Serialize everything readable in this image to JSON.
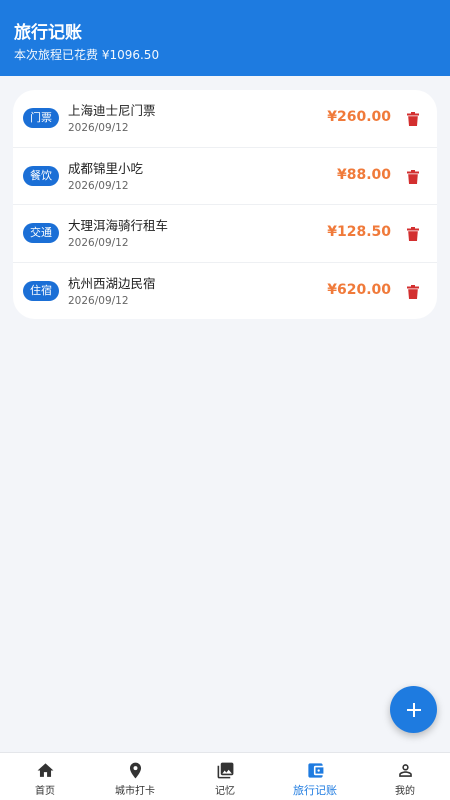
{
  "header": {
    "title": "旅行记账",
    "subtitle": "本次旅程已花费 ¥1096.50"
  },
  "expenses": [
    {
      "category": "门票",
      "name": "上海迪士尼门票",
      "date": "2026/09/12",
      "amount": "¥260.00"
    },
    {
      "category": "餐饮",
      "name": "成都锦里小吃",
      "date": "2026/09/12",
      "amount": "¥88.00"
    },
    {
      "category": "交通",
      "name": "大理洱海骑行租车",
      "date": "2026/09/12",
      "amount": "¥128.50"
    },
    {
      "category": "住宿",
      "name": "杭州西湖边民宿",
      "date": "2026/09/12",
      "amount": "¥620.00"
    }
  ],
  "nav": [
    {
      "label": "首页",
      "icon": "home-icon"
    },
    {
      "label": "城市打卡",
      "icon": "location-pin-icon"
    },
    {
      "label": "记忆",
      "icon": "photo-library-icon"
    },
    {
      "label": "旅行记账",
      "icon": "wallet-icon",
      "active": true
    },
    {
      "label": "我的",
      "icon": "person-icon"
    }
  ],
  "colors": {
    "primary": "#1e7be0",
    "amount": "#f07a3a",
    "delete": "#d32f2f"
  }
}
